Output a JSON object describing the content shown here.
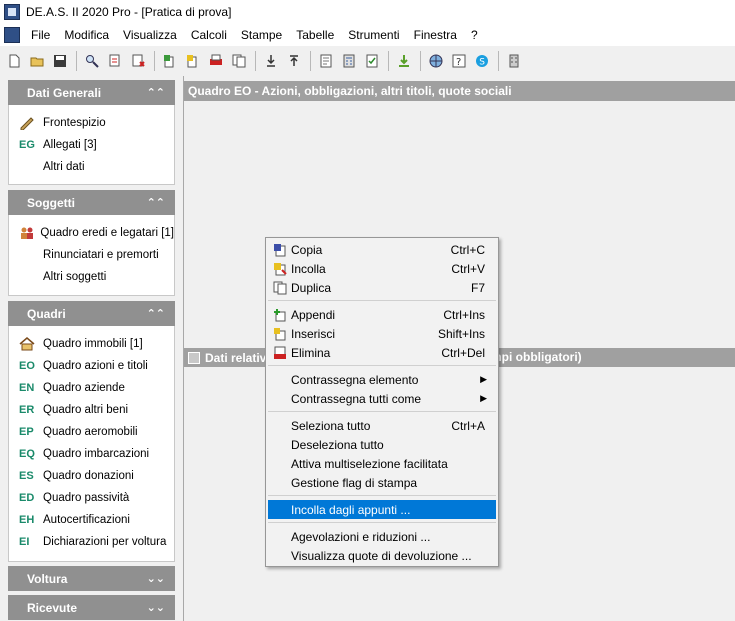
{
  "window": {
    "title": "DE.A.S. II 2020 Pro - [Pratica di prova]"
  },
  "menubar": {
    "items": [
      "File",
      "Modifica",
      "Visualizza",
      "Calcoli",
      "Stampe",
      "Tabelle",
      "Strumenti",
      "Finestra",
      "?"
    ]
  },
  "toolbar": {
    "icons": [
      "new-icon",
      "open-icon",
      "save-icon",
      "find-icon",
      "cut-icon",
      "delete-icon",
      "copy-icon",
      "paste-icon",
      "print-icon",
      "duplicate-icon",
      "import-icon",
      "export-icon",
      "report-icon",
      "calculator-icon",
      "check-icon",
      "download-icon",
      "web-icon",
      "help-icon",
      "skype-icon",
      "building-icon"
    ]
  },
  "sidebar": {
    "panels": [
      {
        "title": "Dati Generali",
        "chevron": "up",
        "items": [
          {
            "code": "",
            "icon": "pen-icon",
            "label": "Frontespizio"
          },
          {
            "code": "EG",
            "icon": "",
            "label": "Allegati [3]"
          },
          {
            "code": "",
            "icon": "",
            "label": "Altri dati"
          }
        ]
      },
      {
        "title": "Soggetti",
        "chevron": "up",
        "items": [
          {
            "code": "",
            "icon": "people-icon",
            "label": "Quadro eredi e legatari [1]"
          },
          {
            "code": "",
            "icon": "",
            "label": "Rinunciatari e premorti"
          },
          {
            "code": "",
            "icon": "",
            "label": "Altri soggetti"
          }
        ]
      },
      {
        "title": "Quadri",
        "chevron": "up",
        "items": [
          {
            "code": "",
            "icon": "house-icon",
            "label": "Quadro immobili [1]"
          },
          {
            "code": "EO",
            "icon": "",
            "label": "Quadro azioni e titoli"
          },
          {
            "code": "EN",
            "icon": "",
            "label": "Quadro aziende"
          },
          {
            "code": "ER",
            "icon": "",
            "label": "Quadro altri beni"
          },
          {
            "code": "EP",
            "icon": "",
            "label": "Quadro aeromobili"
          },
          {
            "code": "EQ",
            "icon": "",
            "label": "Quadro imbarcazioni"
          },
          {
            "code": "ES",
            "icon": "",
            "label": "Quadro donazioni"
          },
          {
            "code": "ED",
            "icon": "",
            "label": "Quadro passività"
          },
          {
            "code": "EH",
            "icon": "",
            "label": "Autocertificazioni"
          },
          {
            "code": "EI",
            "icon": "",
            "label": "Dichiarazioni per voltura"
          }
        ]
      },
      {
        "title": "Voltura",
        "chevron": "down",
        "items": []
      },
      {
        "title": "Ricevute",
        "chevron": "down",
        "items": []
      }
    ]
  },
  "main": {
    "header": "Quadro EO - Azioni, obbligazioni, altri titoli, quote sociali",
    "sub_header_left": "Dati relativ",
    "sub_header_right": "mpi obbligatori)"
  },
  "context_menu": {
    "items": [
      {
        "label": "Copia",
        "shortcut": "Ctrl+C",
        "icon": "copy-icon"
      },
      {
        "label": "Incolla",
        "shortcut": "Ctrl+V",
        "icon": "paste-icon"
      },
      {
        "label": "Duplica",
        "shortcut": "F7",
        "icon": "duplicate-icon"
      },
      {
        "label": "Appendi",
        "shortcut": "Ctrl+Ins",
        "icon": "append-icon"
      },
      {
        "label": "Inserisci",
        "shortcut": "Shift+Ins",
        "icon": "insert-icon"
      },
      {
        "label": "Elimina",
        "shortcut": "Ctrl+Del",
        "icon": "delete-icon"
      },
      {
        "label": "Contrassegna elemento",
        "shortcut": "",
        "submenu": true
      },
      {
        "label": "Contrassegna tutti come",
        "shortcut": "",
        "submenu": true
      },
      {
        "label": "Seleziona tutto",
        "shortcut": "Ctrl+A"
      },
      {
        "label": "Deseleziona tutto",
        "shortcut": ""
      },
      {
        "label": "Attiva multiselezione facilitata",
        "shortcut": ""
      },
      {
        "label": "Gestione flag di stampa",
        "shortcut": ""
      },
      {
        "label": "Incolla dagli appunti ...",
        "shortcut": "",
        "highlighted": true
      },
      {
        "label": "Agevolazioni e riduzioni ...",
        "shortcut": ""
      },
      {
        "label": "Visualizza quote di devoluzione ...",
        "shortcut": ""
      }
    ]
  },
  "colors": {
    "highlight": "#0078d7",
    "code_green": "#1a8a6a",
    "panel_header": "#909090"
  }
}
